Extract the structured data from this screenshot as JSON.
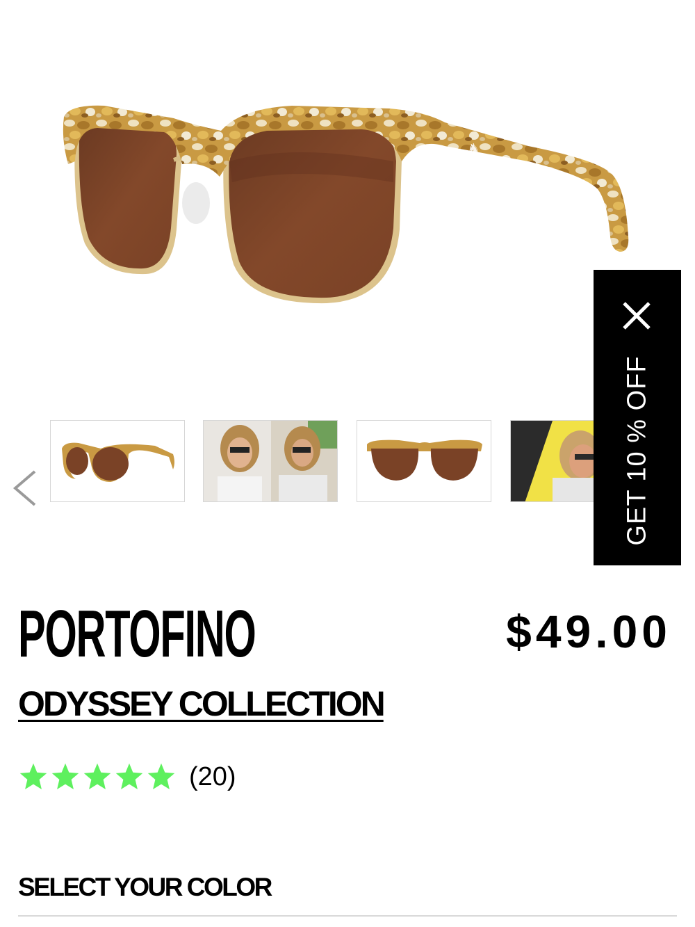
{
  "product": {
    "name": "PORTOFINO",
    "price": "$49.00",
    "collection": "ODYSSEY COLLECTION",
    "rating": 5,
    "rating_max": 5,
    "review_count": "(20)",
    "image": "tortoise-clubmaster-sunglasses-brown-lens"
  },
  "gallery": {
    "prev_icon": "chevron-left-icon",
    "thumbnails": [
      {
        "subject": "sunglasses-side-view"
      },
      {
        "subject": "model-man-wearing-sunglasses"
      },
      {
        "subject": "sunglasses-front-view"
      },
      {
        "subject": "model-woman-wearing-sunglasses"
      }
    ]
  },
  "promo": {
    "label": "GET 10 % OFF",
    "close_icon": "close-icon"
  },
  "options": {
    "color_heading": "SELECT YOUR COLOR"
  },
  "colors": {
    "star": "#5ef05e",
    "tortoise": "#c79a45",
    "lens": "#7a4226",
    "metal": "#d8c08c",
    "promo_bg": "#000000"
  }
}
